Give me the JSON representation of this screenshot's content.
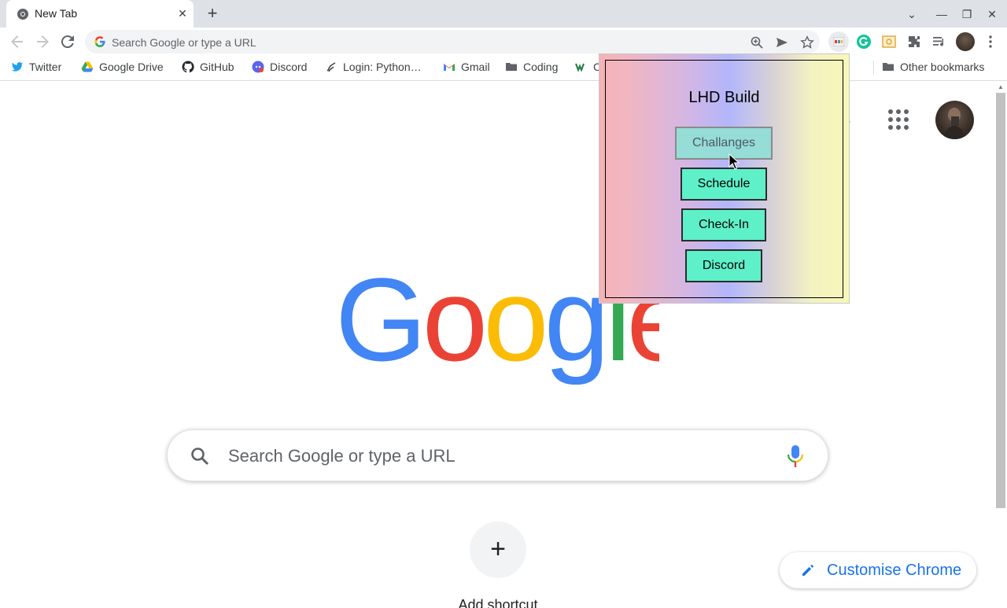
{
  "browser": {
    "tab": {
      "title": "New Tab",
      "close_glyph": "✕"
    },
    "new_tab_glyph": "+",
    "window_controls": {
      "tab_search": "⌄",
      "minimize": "—",
      "restore": "❐",
      "close": "✕"
    },
    "omnibox": {
      "placeholder": "Search Google or type a URL"
    },
    "bookmarks": [
      {
        "label": "Twitter",
        "icon": "twitter-icon"
      },
      {
        "label": "Google Drive",
        "icon": "google-drive-icon"
      },
      {
        "label": "GitHub",
        "icon": "github-icon"
      },
      {
        "label": "Discord",
        "icon": "discord-icon"
      },
      {
        "label": "Login: Python…",
        "icon": "replit-icon"
      },
      {
        "label": "Gmail",
        "icon": "gmail-icon"
      },
      {
        "label": "Coding",
        "icon": "folder-icon"
      },
      {
        "label": "C",
        "icon": "w-icon"
      }
    ],
    "other_bookmarks": "Other bookmarks"
  },
  "ntp": {
    "partial_header_text": "s",
    "search_placeholder": "Search Google or type a URL",
    "add_shortcut_label": "Add shortcut",
    "add_shortcut_glyph": "+",
    "customise_label": "Customise Chrome"
  },
  "popup": {
    "title": "LHD Build",
    "buttons": [
      "Challanges",
      "Schedule",
      "Check-In",
      "Discord"
    ],
    "hovered_button": "Challanges"
  },
  "colors": {
    "google_blue": "#4285F4",
    "google_red": "#EA4335",
    "google_yellow": "#FBBC05",
    "google_green": "#34A853",
    "popup_button": "#5ef0c9",
    "link_blue": "#1a73e8"
  }
}
